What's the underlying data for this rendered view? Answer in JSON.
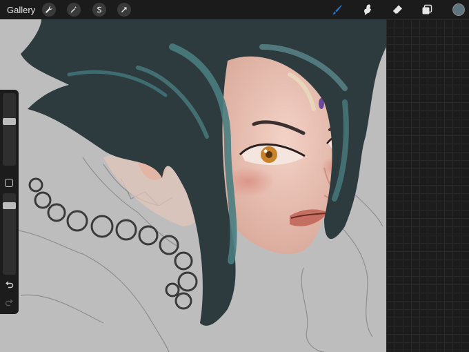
{
  "topbar": {
    "gallery_label": "Gallery",
    "left_tools": [
      "wrench-icon",
      "magic-wand-icon",
      "selection-s-icon",
      "transform-arrow-icon"
    ],
    "right_tools": [
      "brush-icon",
      "smudge-icon",
      "eraser-icon",
      "layers-icon"
    ],
    "active_tool": "brush-icon",
    "current_color": "#5f7680",
    "accent_color": "#1e7bd8"
  },
  "sidebar": {
    "brush_size_level": 0.62,
    "opacity_level": 0.12,
    "buttons": [
      "undo-icon",
      "redo-icon"
    ]
  },
  "canvas": {
    "background_color": "#bdbdbd",
    "hair_color": "#2d3b3e",
    "hair_highlight": "#4a7d80",
    "skin_color": "#ecc5b8",
    "eye_color": "#c8822a"
  }
}
